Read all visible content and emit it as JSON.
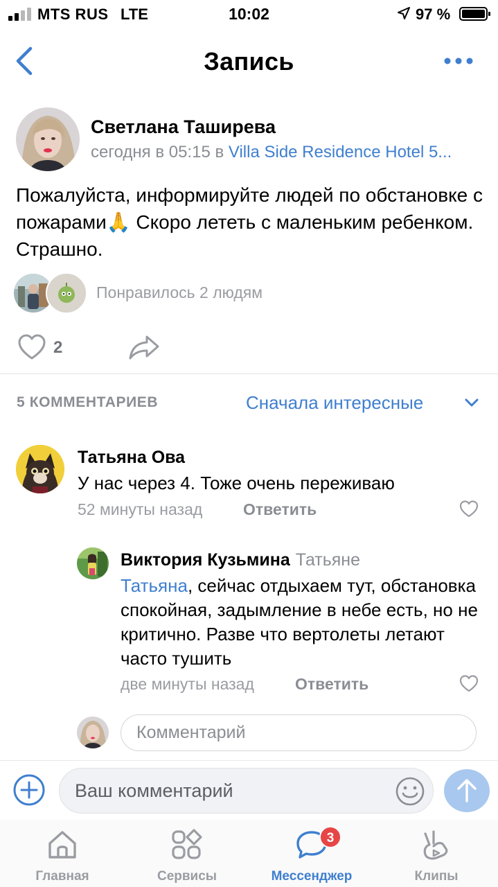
{
  "status_bar": {
    "carrier": "MTS RUS",
    "network": "LTE",
    "time": "10:02",
    "battery": "97 %"
  },
  "nav": {
    "title": "Запись",
    "back_icon": "chevron-left-icon",
    "more_icon": "more-horizontal-icon"
  },
  "post": {
    "author": "Светлана Таширева",
    "meta_prefix": "сегодня в 05:15 в ",
    "location": "Villa Side Residence Hotel 5...",
    "text": "Пожалуйста, информируйте людей по обстановке с пожарами🙏 Скоро лететь с маленьким ребенком. Страшно.",
    "liked_by": "Понравилось 2 людям",
    "like_count": "2"
  },
  "comments": {
    "count_label": "5 КОММЕНТАРИЕВ",
    "sort_label": "Сначала интересные",
    "items": [
      {
        "author": "Татьяна Ова",
        "text": "У нас через 4. Тоже очень переживаю",
        "time": "52 минуты назад",
        "reply_label": "Ответить"
      },
      {
        "author": "Виктория Кузьмина",
        "reply_to": "Татьяне",
        "mention": "Татьяна",
        "text": ", сейчас отдыхаем тут, обстановка спокойная, задымление в небе есть, но не критично. Разве что вертолеты летают часто тушить",
        "time": "две минуты назад",
        "reply_label": "Ответить"
      }
    ],
    "inline_placeholder": "Комментарий"
  },
  "composer": {
    "placeholder": "Ваш комментарий"
  },
  "tabs": [
    {
      "label": "Главная",
      "icon": "home-icon"
    },
    {
      "label": "Сервисы",
      "icon": "services-icon"
    },
    {
      "label": "Мессенджер",
      "icon": "messenger-icon",
      "badge": "3"
    },
    {
      "label": "Клипы",
      "icon": "clips-icon"
    }
  ],
  "colors": {
    "accent": "#3f7fcf",
    "secondary_text": "#8a8d93",
    "badge": "#e64646",
    "send_button": "#a9c8ef"
  }
}
